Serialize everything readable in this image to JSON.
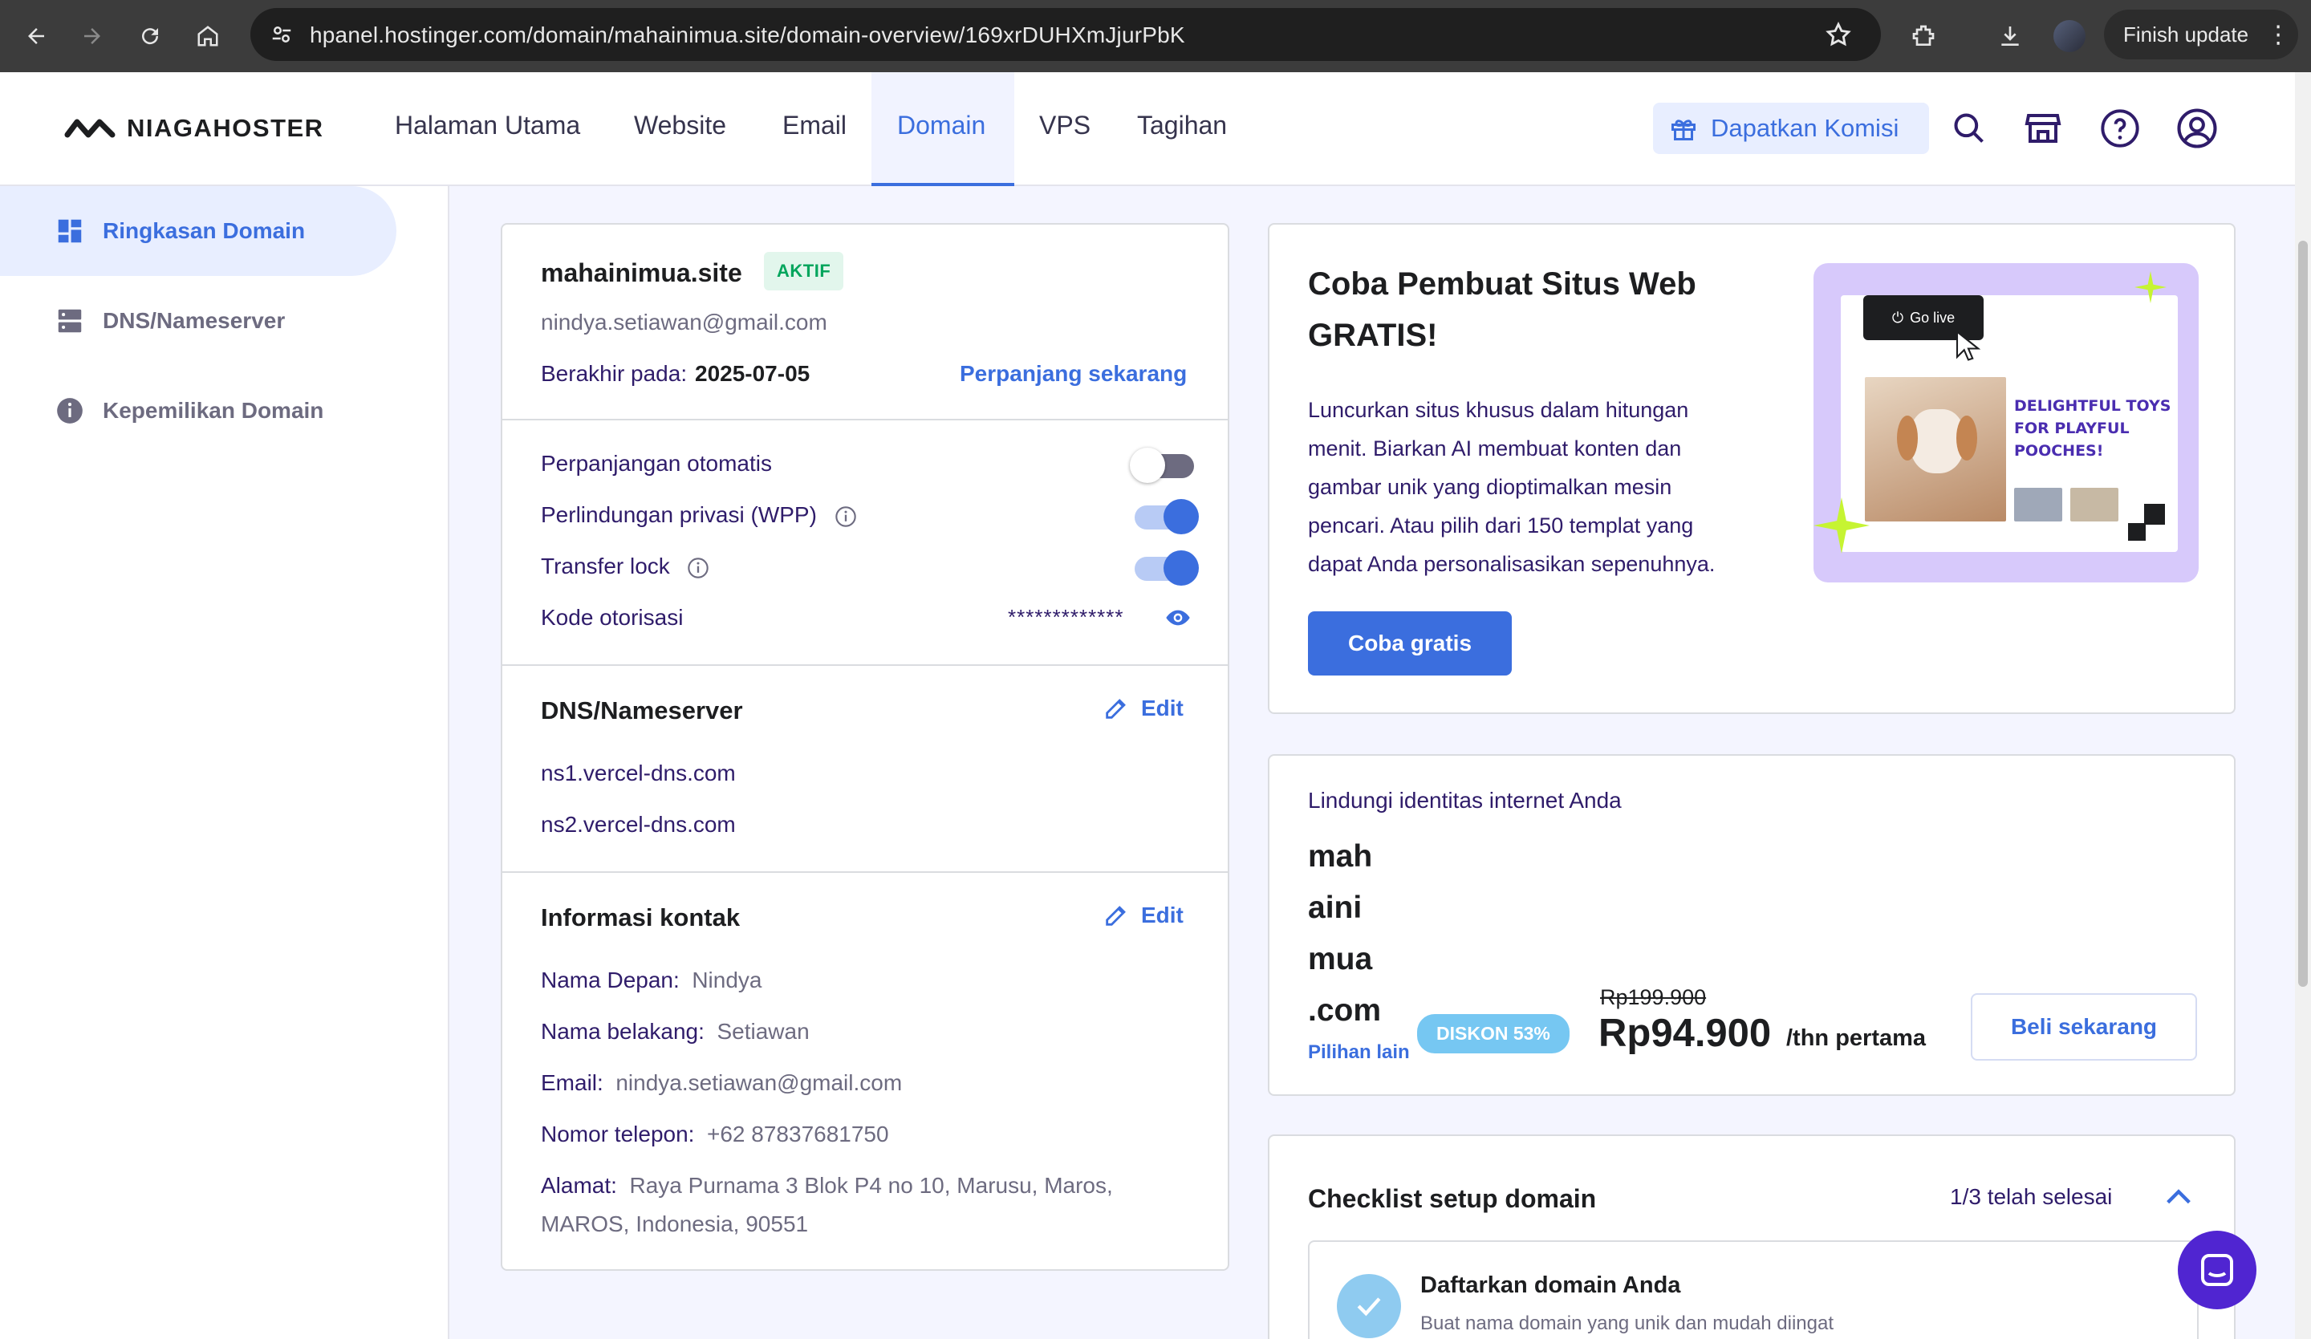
{
  "browser": {
    "url": "hpanel.hostinger.com/domain/mahainimua.site/domain-overview/169xrDUHXmJjurPbK",
    "finish_update": "Finish update"
  },
  "header": {
    "logo_text": "NIAGAHOSTER",
    "nav": [
      "Halaman Utama",
      "Website",
      "Email",
      "Domain",
      "VPS",
      "Tagihan"
    ],
    "active_nav": "Domain",
    "commission_label": "Dapatkan Komisi"
  },
  "sidebar": {
    "items": [
      {
        "label": "Ringkasan Domain",
        "icon": "dashboard-icon",
        "active": true
      },
      {
        "label": "DNS/Nameserver",
        "icon": "server-icon",
        "active": false
      },
      {
        "label": "Kepemilikan Domain",
        "icon": "info-icon",
        "active": false
      }
    ]
  },
  "domain_card": {
    "domain": "mahainimua.site",
    "status": "AKTIF",
    "email": "nindya.setiawan@gmail.com",
    "expires_label": "Berakhir pada:",
    "expires_value": "2025-07-05",
    "renew_link": "Perpanjang sekarang",
    "settings": [
      {
        "label": "Perpanjangan otomatis",
        "on": false,
        "info": false
      },
      {
        "label": "Perlindungan privasi (WPP)",
        "on": true,
        "info": true
      },
      {
        "label": "Transfer lock",
        "on": true,
        "info": true
      }
    ],
    "auth_code_label": "Kode otorisasi",
    "auth_code_value": "*************"
  },
  "dns_section": {
    "title": "DNS/Nameserver",
    "edit_label": "Edit",
    "nameservers": [
      "ns1.vercel-dns.com",
      "ns2.vercel-dns.com"
    ]
  },
  "contact_section": {
    "title": "Informasi kontak",
    "edit_label": "Edit",
    "first_name_label": "Nama Depan:",
    "first_name": "Nindya",
    "last_name_label": "Nama belakang:",
    "last_name": "Setiawan",
    "email_label": "Email:",
    "email": "nindya.setiawan@gmail.com",
    "phone_label": "Nomor telepon:",
    "phone": "+62 87837681750",
    "address_label": "Alamat:",
    "address_line1": "Raya Purnama 3 Blok P4 no 10, Marusu, Maros,",
    "address_line2": "MAROS, Indonesia, 90551"
  },
  "promo_card": {
    "title_line1": "Coba Pembuat Situs Web",
    "title_line2": "GRATIS!",
    "desc_lines": [
      "Luncurkan situs khusus dalam hitungan",
      "menit. Biarkan AI membuat konten dan",
      "gambar unik yang dioptimalkan mesin",
      "pencari. Atau pilih dari 150 templat yang",
      "dapat Anda personalisasikan sepenuhnya."
    ],
    "button": "Coba gratis",
    "image": {
      "go_live": "Go live",
      "headline_line1": "DELIGHTFUL TOYS",
      "headline_line2": "FOR PLAYFUL",
      "headline_line3": "POOCHES!"
    }
  },
  "offer_card": {
    "heading": "Lindungi identitas internet Anda",
    "domain_parts": [
      "mah",
      "aini",
      "mua",
      ".com"
    ],
    "other_options": "Pilihan lain",
    "discount": "DISKON 53%",
    "old_price": "Rp199.900",
    "price": "Rp94.900",
    "period": "/thn pertama",
    "button": "Beli sekarang"
  },
  "checklist_card": {
    "title": "Checklist setup domain",
    "progress": "1/3 telah selesai",
    "item_title": "Daftarkan domain Anda",
    "item_desc": "Buat nama domain yang unik dan mudah diingat"
  }
}
